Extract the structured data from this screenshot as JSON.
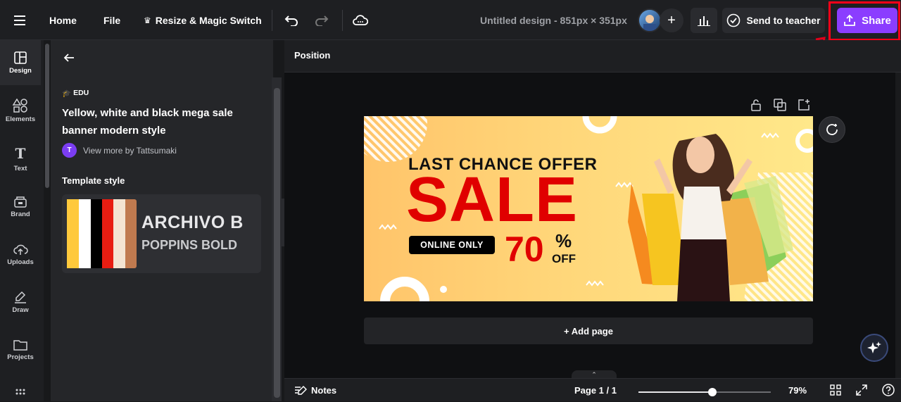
{
  "topbar": {
    "home": "Home",
    "file": "File",
    "resize": "Resize & Magic Switch",
    "design_title": "Untitled design - 851px × 351px",
    "send_to_teacher": "Send to teacher",
    "share": "Share"
  },
  "rail": [
    {
      "label": "Design",
      "icon": "layout-icon"
    },
    {
      "label": "Elements",
      "icon": "shapes-icon"
    },
    {
      "label": "Text",
      "icon": "text-icon"
    },
    {
      "label": "Brand",
      "icon": "brand-icon"
    },
    {
      "label": "Uploads",
      "icon": "upload-icon"
    },
    {
      "label": "Draw",
      "icon": "draw-icon"
    },
    {
      "label": "Projects",
      "icon": "folder-icon"
    }
  ],
  "panel": {
    "badge": "EDU",
    "title": "Yellow, white and black mega sale banner modern style",
    "author_initial": "T",
    "author": "View more by Tattsumaki",
    "template_style": "Template style",
    "font1": "ARCHIVO B",
    "font2": "POPPINS BOLD",
    "swatches": [
      "#ffc93c",
      "#ffffff",
      "#000000",
      "#e81d12",
      "#f4e4d2",
      "#c07a4f"
    ]
  },
  "position_label": "Position",
  "banner": {
    "line1": "LAST CHANCE OFFER",
    "sale": "SALE",
    "online": "ONLINE ONLY",
    "discount": "70",
    "percent": "%",
    "off": "OFF"
  },
  "add_page": "+ Add page",
  "bottom": {
    "notes": "Notes",
    "pages": "Page 1 / 1",
    "zoom_label": "79%",
    "zoom_level": 0.56
  },
  "colors": {
    "accent": "#8b3dff",
    "highlight": "#ff0019",
    "sale_red": "#e00000"
  }
}
